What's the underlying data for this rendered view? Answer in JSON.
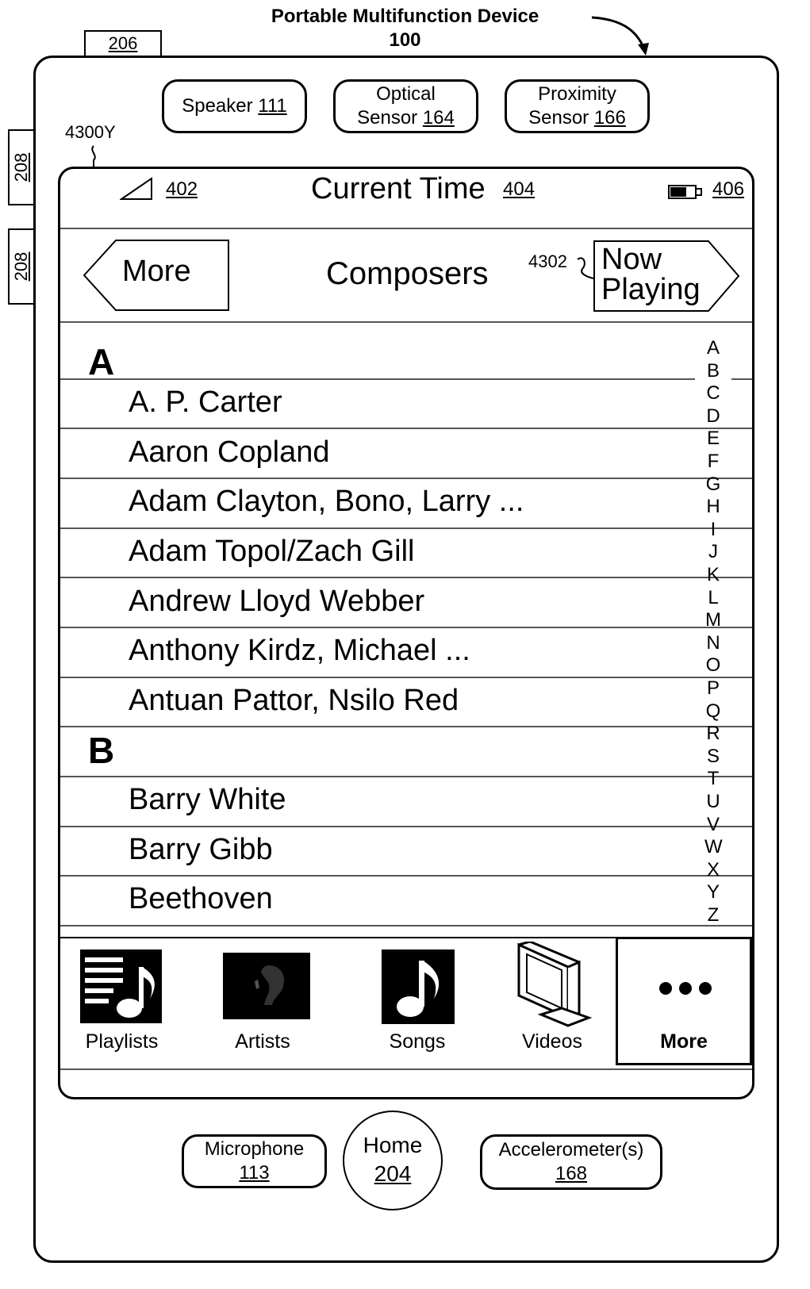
{
  "figure": {
    "title": "Portable Multifunction Device",
    "title_number": "100",
    "ref_206": "206",
    "ref_208_a": "208",
    "ref_208_b": "208",
    "ref_screen": "4300Y",
    "ref_now_playing": "4302"
  },
  "hardware_top": {
    "speaker": {
      "label": "Speaker",
      "ref": "111"
    },
    "optical": {
      "label_line1": "Optical",
      "label_line2": "Sensor",
      "ref": "164"
    },
    "proximity": {
      "label_line1": "Proximity",
      "label_line2": "Sensor",
      "ref": "166"
    }
  },
  "status_bar": {
    "signal_ref": "402",
    "time_label": "Current Time",
    "time_ref": "404",
    "battery_ref": "406"
  },
  "nav_bar": {
    "back_label": "More",
    "title": "Composers",
    "now_playing_line1": "Now",
    "now_playing_line2": "Playing"
  },
  "list": {
    "section_a": "A",
    "section_b": "B",
    "items_a": [
      "A. P. Carter",
      "Aaron Copland",
      "Adam Clayton, Bono, Larry ...",
      "Adam Topol/Zach Gill",
      "Andrew Lloyd Webber",
      "Anthony Kirdz, Michael ...",
      "Antuan Pattor, Nsilo Red"
    ],
    "items_b": [
      "Barry White",
      "Barry Gibb",
      "Beethoven"
    ]
  },
  "index_letters": [
    "A",
    "B",
    "C",
    "D",
    "E",
    "F",
    "G",
    "H",
    "I",
    "J",
    "K",
    "L",
    "M",
    "N",
    "O",
    "P",
    "Q",
    "R",
    "S",
    "T",
    "U",
    "V",
    "W",
    "X",
    "Y",
    "Z"
  ],
  "tab_bar": {
    "playlists": "Playlists",
    "artists": "Artists",
    "songs": "Songs",
    "videos": "Videos",
    "more": "More",
    "selected": "More"
  },
  "hardware_bottom": {
    "microphone": {
      "label": "Microphone",
      "ref": "113"
    },
    "home": {
      "label": "Home",
      "ref": "204"
    },
    "accelerometer": {
      "label": "Accelerometer(s)",
      "ref": "168"
    }
  }
}
